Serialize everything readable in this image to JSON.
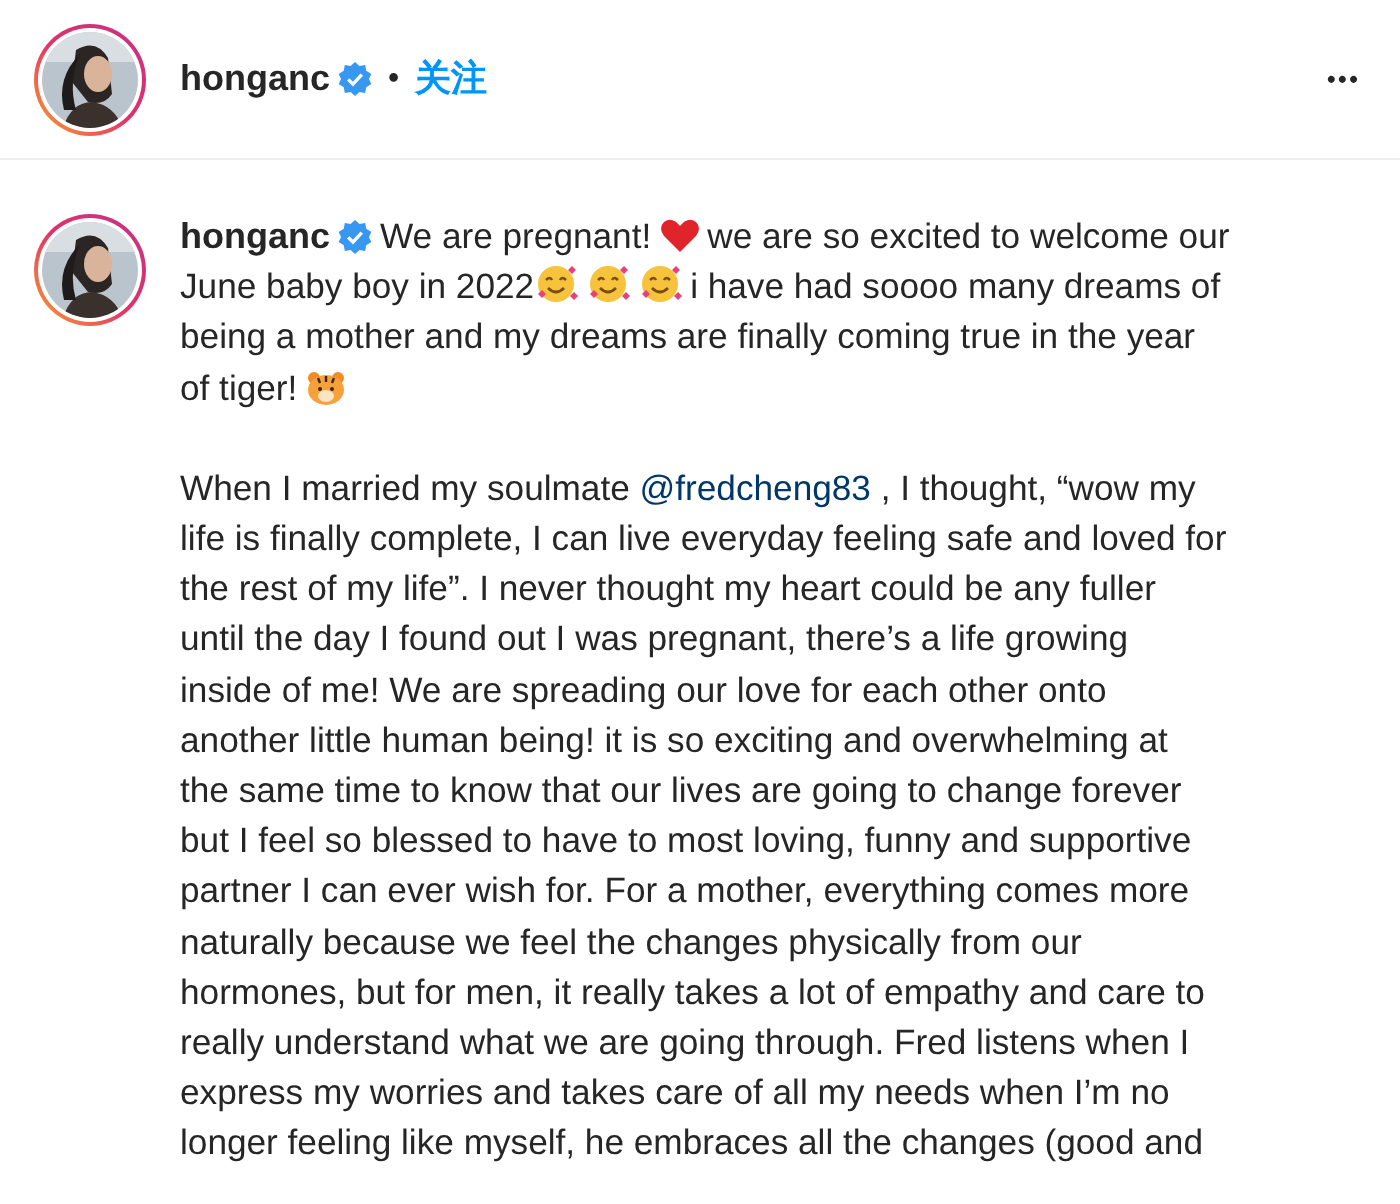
{
  "header": {
    "username": "honganc",
    "separator": "•",
    "follow": "关注",
    "more": "•••"
  },
  "post": {
    "paragraphs": [
      [
        [
          {
            "kind": "user",
            "text": "honganc"
          },
          {
            "kind": "verified"
          },
          {
            "kind": "text",
            "text": "We are pregnant!"
          },
          {
            "kind": "heart"
          },
          {
            "kind": "text",
            "text": "we are so excited to welcome our"
          }
        ],
        [
          {
            "kind": "text",
            "text": "June baby boy in 2022"
          },
          {
            "kind": "smile"
          },
          {
            "kind": "smile"
          },
          {
            "kind": "smile"
          },
          {
            "kind": "text",
            "text": "i have had soooo many dreams of"
          }
        ],
        [
          {
            "kind": "text",
            "text": "being a mother and my dreams are finally coming true in the year"
          }
        ],
        [
          {
            "kind": "text",
            "text": "of tiger!"
          },
          {
            "kind": "tiger"
          }
        ]
      ],
      [
        [
          {
            "kind": "text",
            "text": "When I married my soulmate"
          },
          {
            "kind": "mention",
            "text": "@fredcheng83"
          },
          {
            "kind": "text",
            "text": ", I thought, “wow my"
          }
        ],
        [
          {
            "kind": "text",
            "text": "life is finally complete, I can live everyday feeling safe and loved for"
          }
        ],
        [
          {
            "kind": "text",
            "text": "the rest of my life”. I never thought my heart could be any fuller"
          }
        ],
        [
          {
            "kind": "text",
            "text": "until the day I found out I was pregnant, there’s a life growing"
          }
        ],
        [
          {
            "kind": "text",
            "text": "inside of me! We are spreading our love for each other onto"
          }
        ],
        [
          {
            "kind": "text",
            "text": "another little human being! it is so exciting and overwhelming at"
          }
        ],
        [
          {
            "kind": "text",
            "text": "the same time to know that our lives are going to change forever"
          }
        ],
        [
          {
            "kind": "text",
            "text": "but I feel so blessed to have to most loving, funny and supportive"
          }
        ],
        [
          {
            "kind": "text",
            "text": "partner I can ever wish for. For a mother, everything comes more"
          }
        ],
        [
          {
            "kind": "text",
            "text": "naturally because we feel the changes physically from our"
          }
        ],
        [
          {
            "kind": "text",
            "text": "hormones, but for men, it really takes a lot of empathy and care to"
          }
        ],
        [
          {
            "kind": "text",
            "text": "really understand what we are going through. Fred listens when I"
          }
        ],
        [
          {
            "kind": "text",
            "text": "express my worries and takes care of all my needs when I’m no"
          }
        ],
        [
          {
            "kind": "text",
            "text": "longer feeling like myself, he embraces all the changes (good and"
          }
        ]
      ]
    ]
  }
}
